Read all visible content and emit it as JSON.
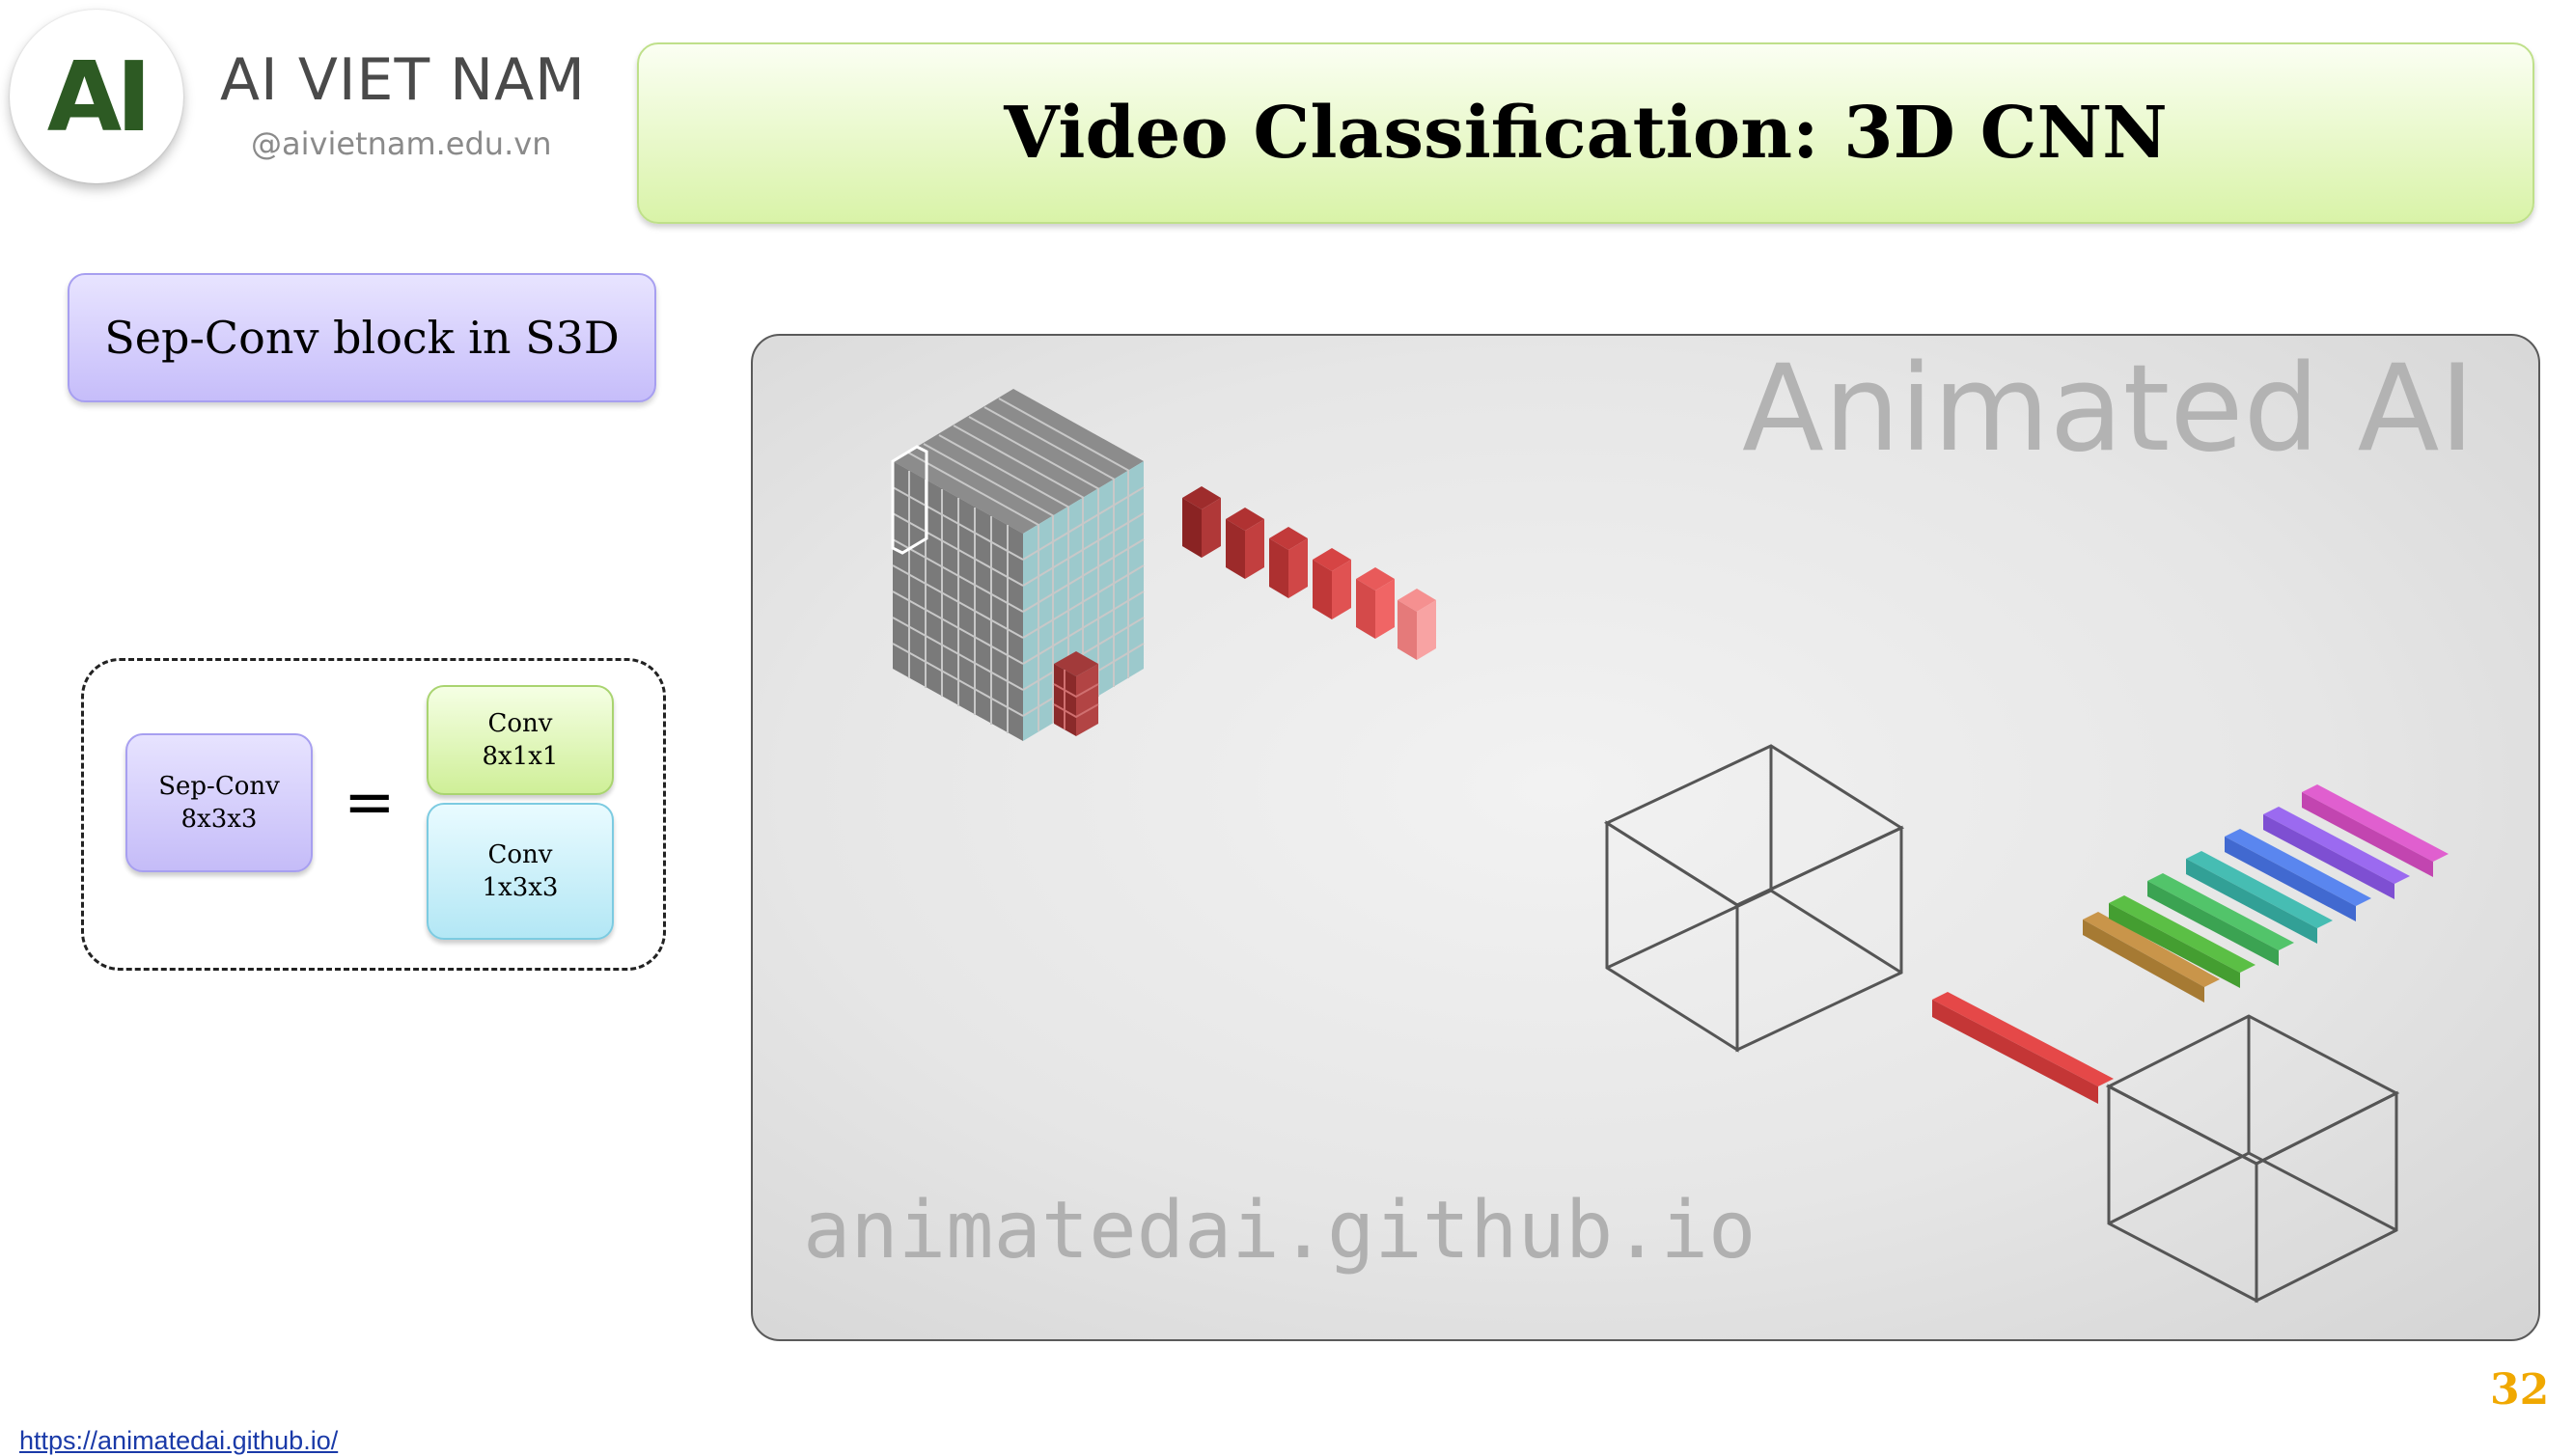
{
  "brand": {
    "logo_text": "AI",
    "name": "AI VIET NAM",
    "site": "@aivietnam.edu.vn"
  },
  "title": "Video Classification: 3D CNN",
  "section_label": "Sep-Conv block in S3D",
  "equation": {
    "left_box": {
      "line1": "Sep-Conv",
      "line2": "8x3x3"
    },
    "sign": "=",
    "right_top": {
      "line1": "Conv",
      "line2": "8x1x1"
    },
    "right_bottom": {
      "line1": "Conv",
      "line2": "1x3x3"
    }
  },
  "animation": {
    "watermark": "Animated AI",
    "url_watermark": "animatedai.github.io"
  },
  "footer": {
    "link": "https://animatedai.github.io/",
    "page_number": "32"
  },
  "colors": {
    "title_green": "#d9f3a8",
    "label_purple": "#c6bdfa",
    "conv_blue": "#b3e7f5",
    "page_num": "#f0a800",
    "logo_green": "#2d5a23"
  }
}
